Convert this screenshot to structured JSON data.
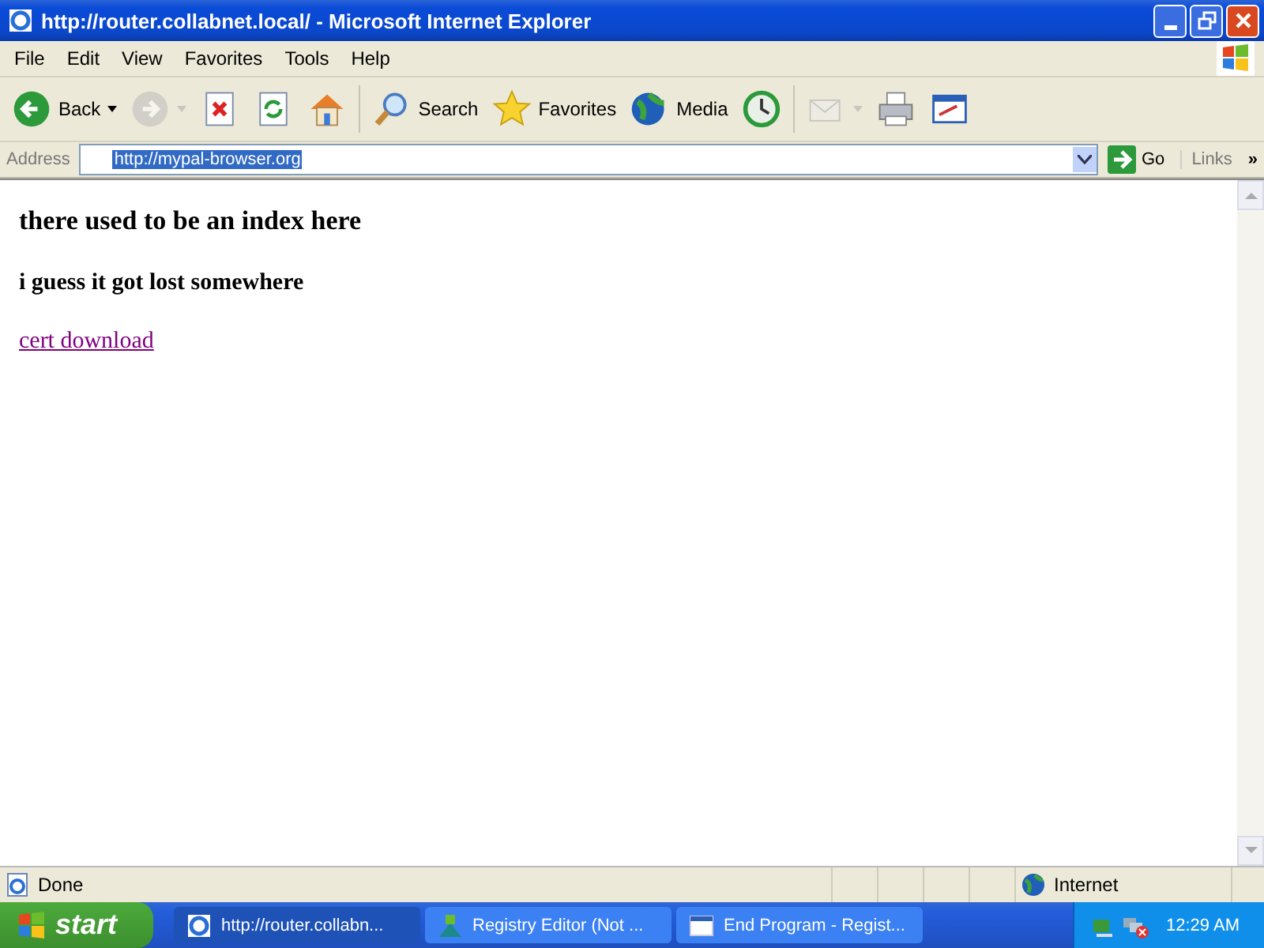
{
  "window": {
    "title": "http://router.collabnet.local/ - Microsoft Internet Explorer"
  },
  "menu": [
    "File",
    "Edit",
    "View",
    "Favorites",
    "Tools",
    "Help"
  ],
  "toolbar": [
    {
      "kind": "back",
      "label": "Back",
      "disabled": false
    },
    {
      "kind": "forward",
      "disabled": true
    },
    {
      "kind": "stop",
      "disabled": false
    },
    {
      "kind": "refresh",
      "disabled": false
    },
    {
      "kind": "home",
      "disabled": false
    },
    {
      "kind": "search",
      "label": "Search",
      "disabled": false
    },
    {
      "kind": "favorites",
      "label": "Favorites",
      "disabled": false
    },
    {
      "kind": "media",
      "label": "Media",
      "disabled": false
    },
    {
      "kind": "history",
      "disabled": false
    },
    {
      "kind": "mail",
      "disabled": true
    },
    {
      "kind": "print",
      "disabled": false
    },
    {
      "kind": "edit",
      "disabled": false
    }
  ],
  "address": {
    "label": "Address",
    "value": "http://mypal-browser.org",
    "go": "Go",
    "links": "Links",
    "links_more": "»"
  },
  "page": {
    "heading": "there used to be an index here",
    "subheading": "i guess it got lost somewhere",
    "link": "cert download"
  },
  "status_bar": {
    "text": "Done",
    "zone": "Internet"
  },
  "taskbar": {
    "start": "start",
    "tasks": [
      {
        "label": "http://router.collabn...",
        "selected": true,
        "kind": "ie"
      },
      {
        "label": "Registry Editor (Not ...",
        "selected": false,
        "kind": "regedit"
      },
      {
        "label": "End Program - Regist...",
        "selected": false,
        "kind": "window"
      }
    ],
    "clock": "12:29 AM"
  }
}
